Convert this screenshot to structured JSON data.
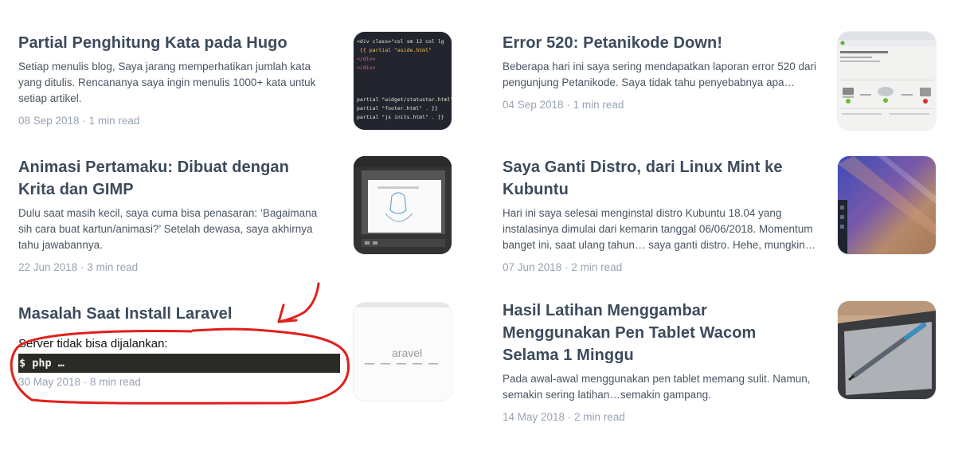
{
  "cards": [
    {
      "title": "Partial Penghitung Kata pada Hugo",
      "excerpt": "Setiap menulis blog, Saya jarang memperhatikan jumlah kata yang ditulis. Rencananya saya ingin menulis 1000+ kata untuk setiap artikel.",
      "meta": "08 Sep 2018 · 1 min read",
      "thumb": {
        "code_lines": [
          "<div class=\"col sm 12 col lg",
          "  {{ partial \"aside.html\"",
          "</div>",
          "</div>",
          "",
          "partial \"widget/statustar.html\"",
          "partial \"footer.html\" . }}",
          "partial \"js inits.html\" . }}"
        ]
      }
    },
    {
      "title": "Error 520: Petanikode Down!",
      "excerpt": "Beberapa hari ini saya sering mendapatkan laporan error 520 dari pengunjung Petanikode. Saya tidak tahu penyebabnya apa…",
      "meta": "04 Sep 2018 · 1 min read"
    },
    {
      "title": "Animasi Pertamaku: Dibuat dengan Krita dan GIMP",
      "excerpt": "Dulu saat masih kecil, saya cuma bisa penasaran: ‘Bagaimana sih cara buat kartun/animasi?’ Setelah dewasa, saya akhirnya tahu jawabannya.",
      "meta": "22 Jun 2018 · 3 min read"
    },
    {
      "title": "Saya Ganti Distro, dari Linux Mint ke Kubuntu",
      "excerpt": "Hari ini saya selesai menginstal distro Kubuntu 18.04 yang instalasinya dimulai dari kemarin tanggal 06/06/2018. Momentum banget ini, saat ulang tahun… saya ganti distro. Hehe, mungkin…",
      "meta": "07 Jun 2018 · 2 min read"
    },
    {
      "title": "Masalah Saat Install Laravel",
      "code_label": "Server tidak bisa dijalankan:",
      "code_line": "$ php …",
      "meta": "30 May 2018 · 8 min read",
      "thumb": {
        "word": "aravel"
      }
    },
    {
      "title": "Hasil Latihan Menggambar Menggunakan Pen Tablet Wacom Selama 1 Minggu",
      "excerpt": "Pada awal-awal menggunakan pen tablet memang sulit. Namun, semakin sering latihan…semakin gampang.",
      "meta": "14 May 2018 · 2 min read"
    }
  ],
  "colors": {
    "annotation": "#e0201c",
    "meta": "#98a3b3",
    "title": "#3c4a5c"
  }
}
